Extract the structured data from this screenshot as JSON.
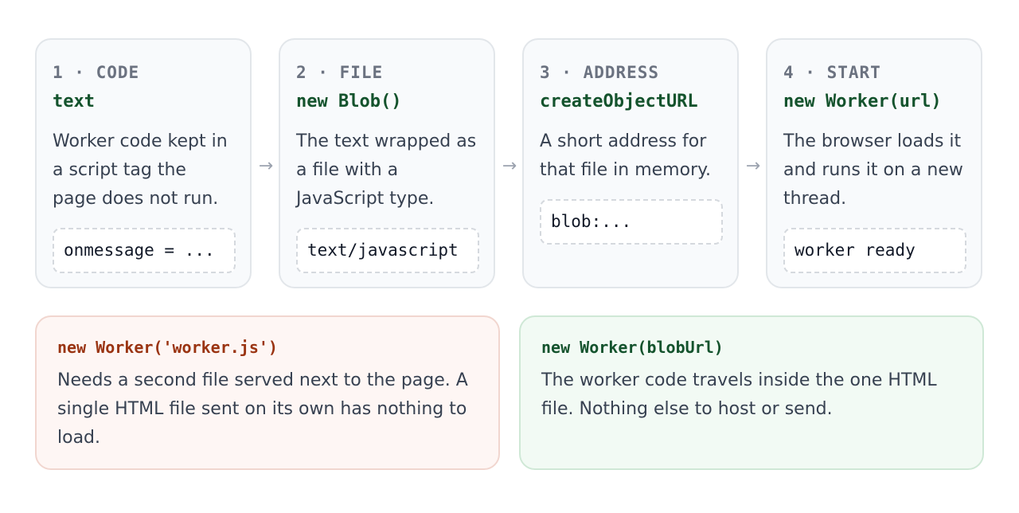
{
  "steps": [
    {
      "label": "1 · CODE",
      "code": "text",
      "description": "Worker code kept in a script tag the page does not run.",
      "chip": "onmessage = ..."
    },
    {
      "label": "2 · FILE",
      "code": "new Blob()",
      "description": "The text wrapped as a file with a JavaScript type.",
      "chip": "text/javascript"
    },
    {
      "label": "3 · ADDRESS",
      "code": "createObjectURL",
      "description": "A short address for that file in memory.",
      "chip": "blob:..."
    },
    {
      "label": "4 · START",
      "code": "new Worker(url)",
      "description": "The browser loads it and runs it on a new thread.",
      "chip": "worker ready"
    }
  ],
  "arrows": [
    "→",
    "→",
    "→"
  ],
  "comparison": {
    "bad": {
      "code": "new Worker('worker.js')",
      "description": "Needs a second file served next to the page. A single HTML file sent on its own has nothing to load."
    },
    "good": {
      "code": "new Worker(blobUrl)",
      "description": "The worker code travels inside the one HTML file. Nothing else to host or send."
    }
  },
  "colors": {
    "step_code": "#14532d",
    "bad_code": "#9a3412",
    "good_code": "#14532d",
    "bad_bg": "#fef6f4",
    "good_bg": "#f2faf4"
  }
}
